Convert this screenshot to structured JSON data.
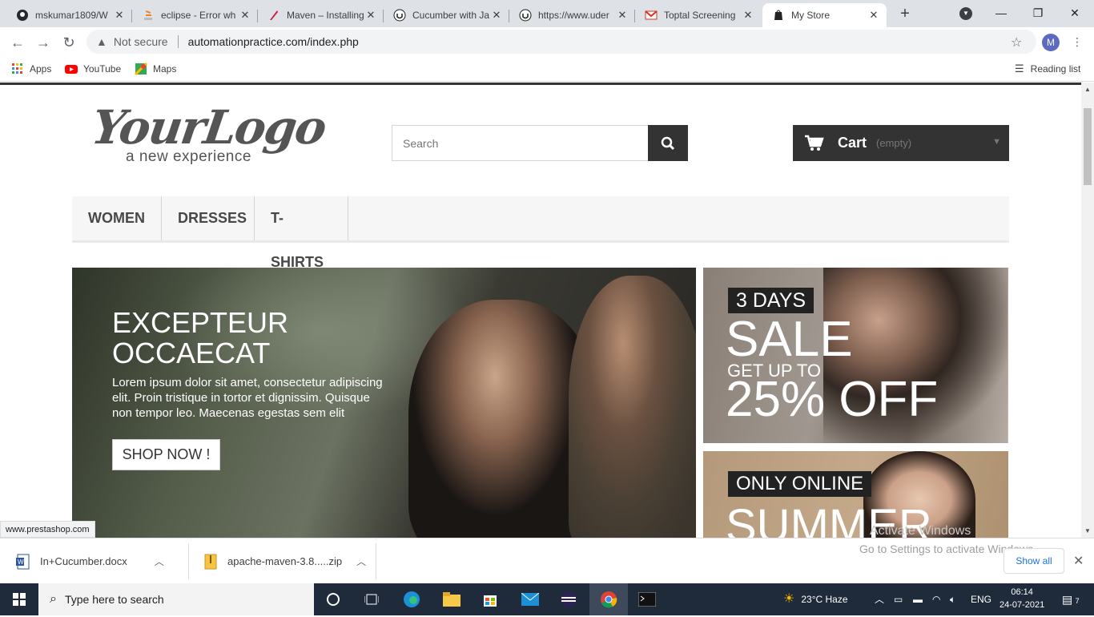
{
  "browser": {
    "tabs": [
      {
        "title": "mskumar1809/W",
        "icon": "github-icon"
      },
      {
        "title": "eclipse - Error wh",
        "icon": "stackoverflow-icon"
      },
      {
        "title": "Maven – Installing",
        "icon": "maven-feather-icon"
      },
      {
        "title": "Cucumber with Ja",
        "icon": "udemy-icon"
      },
      {
        "title": "https://www.uder",
        "icon": "udemy-icon"
      },
      {
        "title": "Toptal Screening",
        "icon": "gmail-icon"
      },
      {
        "title": "My Store",
        "icon": "store-icon"
      }
    ],
    "active_tab": "My Store",
    "security_label": "Not secure",
    "url": "automationpractice.com/index.php",
    "profile_initial": "M",
    "bookmarks": [
      {
        "label": "Apps",
        "icon": "apps-grid-icon"
      },
      {
        "label": "YouTube",
        "icon": "youtube-icon"
      },
      {
        "label": "Maps",
        "icon": "maps-icon"
      }
    ],
    "reading_list": "Reading list",
    "status_url": "www.prestashop.com"
  },
  "store": {
    "logo_main": "YourLogo",
    "logo_tagline": "a new experience",
    "search_placeholder": "Search",
    "cart_label": "Cart",
    "cart_status": "(empty)",
    "menu": [
      "WOMEN",
      "DRESSES",
      "T-SHIRTS"
    ],
    "slide": {
      "heading_line1": "EXCEPTEUR",
      "heading_line2": "OCCAECAT",
      "body": "Lorem ipsum dolor sit amet, consectetur adipiscing elit. Proin tristique in tortor et dignissim. Quisque non tempor leo. Maecenas egestas sem elit",
      "button": "SHOP NOW !"
    },
    "banner1": {
      "tag": "3 DAYS",
      "line1": "SALE",
      "line2": "GET UP TO",
      "line3": "25% OFF"
    },
    "banner2": {
      "tag": "ONLY ONLINE",
      "line1": "SUMMER"
    }
  },
  "downloads": {
    "items": [
      {
        "name": "In+Cucumber.docx",
        "icon": "word-doc-icon"
      },
      {
        "name": "apache-maven-3.8.....zip",
        "icon": "zip-archive-icon"
      }
    ],
    "show_all": "Show all",
    "watermark_line1": "Activate Windows",
    "watermark_line2": "Go to Settings to activate Windows."
  },
  "taskbar": {
    "search_placeholder": "Type here to search",
    "weather": "23°C  Haze",
    "language": "ENG",
    "time": "06:14",
    "date": "24-07-2021",
    "notifications": "7"
  }
}
